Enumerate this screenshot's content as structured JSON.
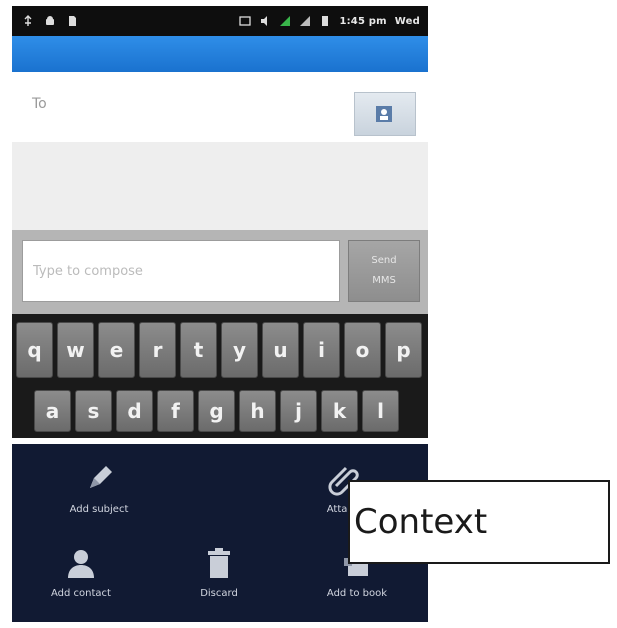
{
  "status_bar": {
    "time": "1:45 pm",
    "network": "Wed",
    "icons": [
      "usb-icon",
      "android-icon",
      "sd-card-icon",
      "photo-icon",
      "volume-icon",
      "wifi-icon",
      "signal-icon",
      "battery-icon"
    ]
  },
  "to_field": {
    "label": "To",
    "value": ""
  },
  "compose": {
    "placeholder": "Type to compose",
    "send_label_line1": "Send",
    "send_label_line2": "MMS"
  },
  "keyboard": {
    "row1": [
      "q",
      "w",
      "e",
      "r",
      "t",
      "y",
      "u",
      "i",
      "o",
      "p"
    ],
    "row2": [
      "a",
      "s",
      "d",
      "f",
      "g",
      "h",
      "j",
      "k",
      "l"
    ]
  },
  "attach_menu": {
    "items": [
      {
        "label": "Add subject",
        "icon": "pencil-icon"
      },
      {
        "label": "Attach",
        "icon": "paperclip-icon"
      },
      {
        "label": "Add contact",
        "icon": "person-icon"
      },
      {
        "label": "Discard",
        "icon": "trash-icon"
      },
      {
        "label": "Add to book",
        "icon": "book-icon"
      }
    ]
  },
  "callout": {
    "label": "Context"
  },
  "colors": {
    "action_bar": "#1a72cf",
    "menu_bg": "#111a33",
    "keyboard_bg": "#1a1a1a"
  }
}
